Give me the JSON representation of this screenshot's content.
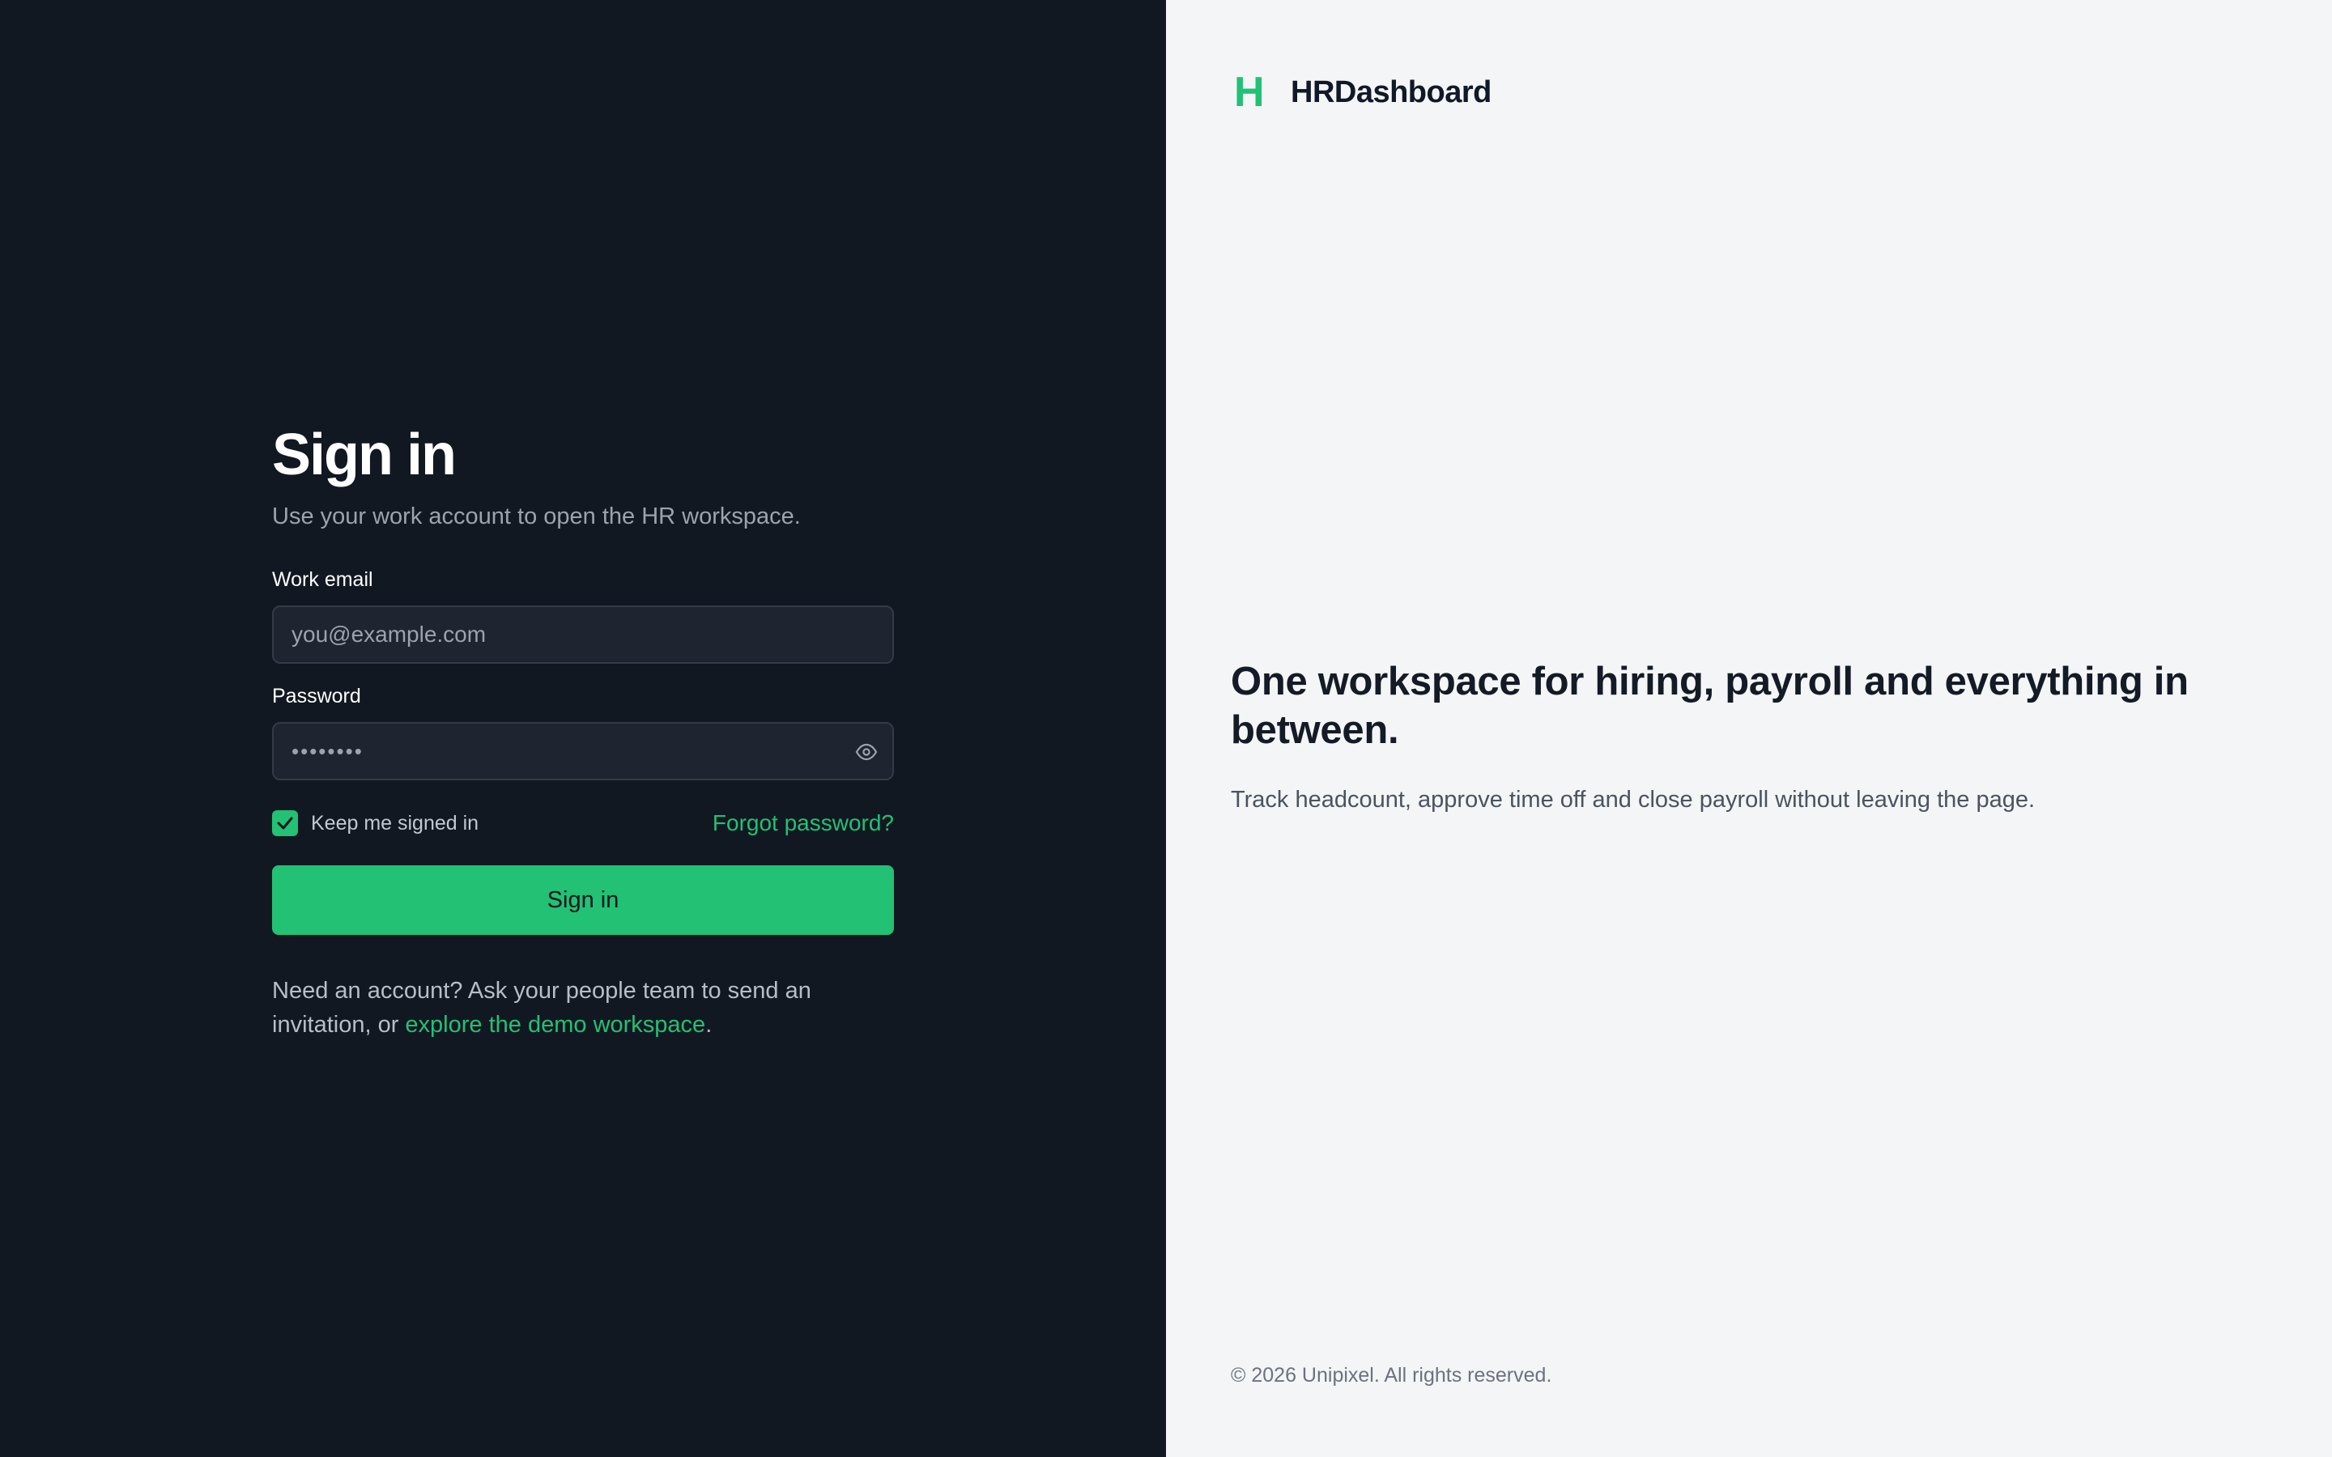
{
  "signin": {
    "title": "Sign in",
    "subtitle": "Use your work account to open the HR workspace.",
    "email_label": "Work email",
    "email_placeholder": "you@example.com",
    "password_label": "Password",
    "password_value": "••••••••",
    "remember_label": "Keep me signed in",
    "remember_checked": true,
    "forgot_link": "Forgot password?",
    "submit_label": "Sign in",
    "footer_text": "Need an account? Ask your people team to send an invitation, or ",
    "footer_link": "explore the demo workspace",
    "footer_end": "."
  },
  "brand": {
    "mark": "H",
    "name": "HRDashboard"
  },
  "hero": {
    "headline": "One workspace for hiring, payroll and everything in between.",
    "tagline": "Track headcount, approve time off and close payroll without leaving the page."
  },
  "footer": {
    "copyright": "© 2026 Unipixel. All rights reserved."
  },
  "icons": {
    "password_toggle": "eye-icon",
    "checkbox": "checkmark-icon"
  },
  "colors": {
    "accent": "#22c174",
    "dark_bg": "#121821",
    "light_bg": "#f4f5f7"
  }
}
